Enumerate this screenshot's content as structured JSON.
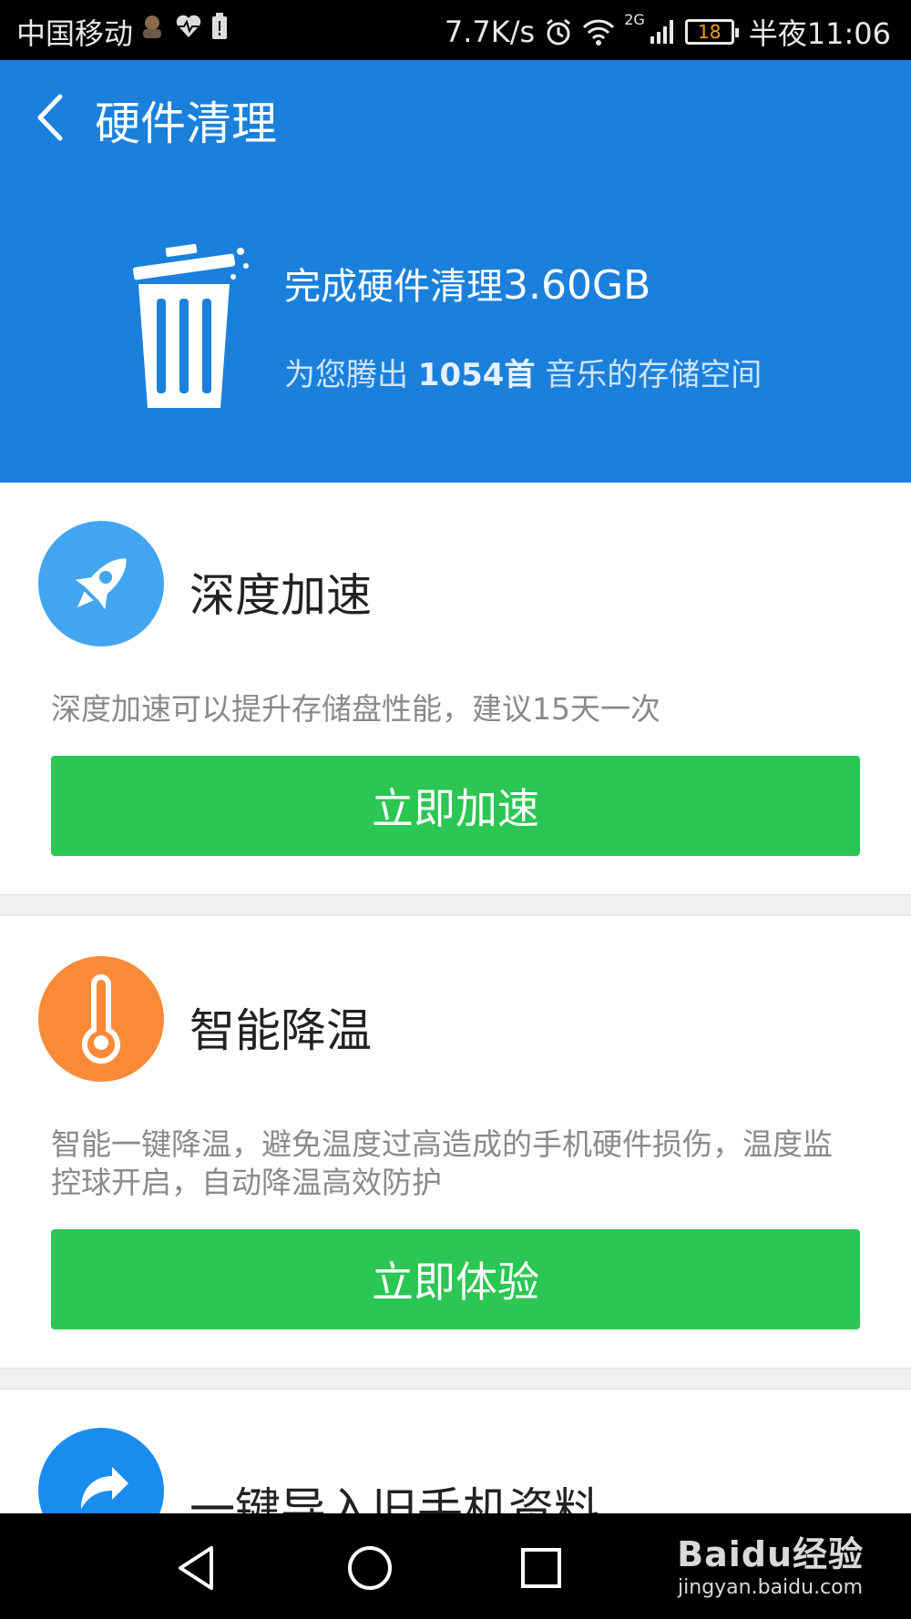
{
  "status_bar": {
    "carrier": "中国移动",
    "speed": "7.7K/s",
    "network": "2G",
    "battery": "18",
    "time": "半夜11:06"
  },
  "header": {
    "title": "硬件清理",
    "result_prefix": "完成硬件清理",
    "result_amount": "3.60GB",
    "sub_prefix": "为您腾出",
    "sub_highlight": "1054首",
    "sub_suffix": "音乐的存储空间"
  },
  "cards": [
    {
      "title": "深度加速",
      "description": "深度加速可以提升存储盘性能，建议15天一次",
      "button": "立即加速",
      "icon": "rocket-icon",
      "color": "#42a5ef"
    },
    {
      "title": "智能降温",
      "description": "智能一键降温，避免温度过高造成的手机硬件损伤，温度监控球开启，自动降温高效防护",
      "button": "立即体验",
      "icon": "thermometer-icon",
      "color": "#fb8a38"
    },
    {
      "title": "一键导入旧手机资料",
      "icon": "transfer-icon",
      "color": "#1a8cf0"
    }
  ],
  "watermark": {
    "main": "Baidu经验",
    "sub": "jingyan.baidu.com"
  },
  "colors": {
    "header_blue": "#1a80dc",
    "button_green": "#2bc653"
  }
}
